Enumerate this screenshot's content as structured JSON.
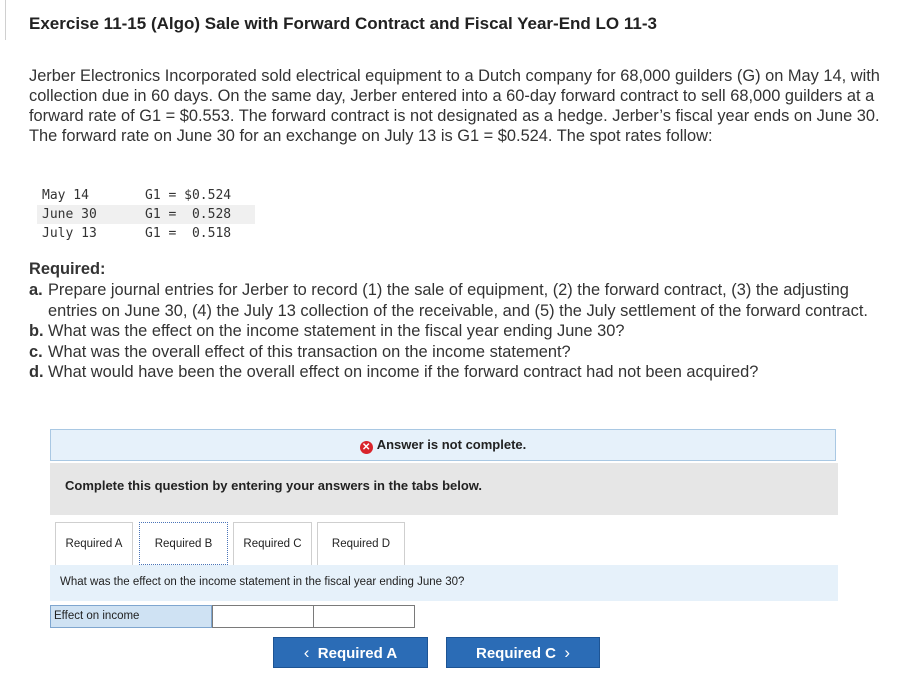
{
  "title": "Exercise 11-15 (Algo) Sale with Forward Contract and Fiscal Year-End LO 11-3",
  "problem_text": "Jerber Electronics Incorporated sold electrical equipment to a Dutch company for 68,000 guilders (G) on May 14, with collection due in 60 days. On the same day, Jerber entered into a 60-day forward contract to sell 68,000 guilders at a forward rate of G1 = $0.553. The forward contract is not designated as a hedge. Jerber’s fiscal year ends on June 30. The forward rate on June 30 for an exchange on July 13 is G1 = $0.524. The spot rates follow:",
  "spot_rates": [
    {
      "date": "May 14",
      "rate": "G1 = $0.524"
    },
    {
      "date": "June 30",
      "rate": "G1 =  0.528"
    },
    {
      "date": "July 13",
      "rate": "G1 =  0.518"
    }
  ],
  "required_heading": "Required:",
  "requirements": [
    {
      "letter": "a.",
      "text": "Prepare journal entries for Jerber to record (1) the sale of equipment, (2) the forward contract, (3) the adjusting entries on June 30, (4) the July 13 collection of the receivable, and (5) the July settlement of the forward contract."
    },
    {
      "letter": "b.",
      "text": "What was the effect on the income statement in the fiscal year ending June 30?"
    },
    {
      "letter": "c.",
      "text": "What was the overall effect of this transaction on the income statement?"
    },
    {
      "letter": "d.",
      "text": "What would have been the overall effect on income if the forward contract had not been acquired?"
    }
  ],
  "status": {
    "text": "Answer is not complete.",
    "icon": "x-circle-icon",
    "color": "#d9242b"
  },
  "instructions": "Complete this question by entering your answers in the tabs below.",
  "tabs": [
    "Required A",
    "Required B",
    "Required C",
    "Required D"
  ],
  "active_tab": "Required B",
  "question": "What was the effect on the income statement in the fiscal year ending June 30?",
  "answer_row": {
    "label": "Effect on income",
    "amount": "",
    "effect": ""
  },
  "nav": {
    "prev": "Required A",
    "next": "Required C"
  },
  "colors": {
    "button": "#2b6cb6",
    "panel": "#e6f1fa",
    "label_cell": "#cfe2f3"
  }
}
